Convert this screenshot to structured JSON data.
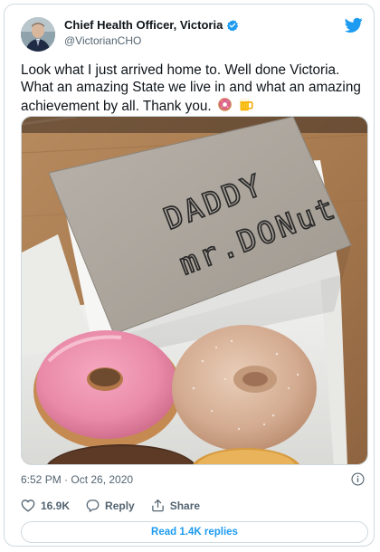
{
  "author": {
    "display_name": "Chief Health Officer, Victoria",
    "handle": "@VictorianCHO",
    "verified": true,
    "avatar_icon": "profile-photo-icon"
  },
  "brand": {
    "logo_icon": "twitter-bird-icon",
    "accent_color": "#1d9bf0"
  },
  "tweet": {
    "text": "Look what I just arrived home to. Well done Victoria. What an amazing State we live in and what an amazing achievement by all. Thank you.",
    "emojis": [
      "donut-emoji-icon",
      "beer-mug-emoji-icon"
    ],
    "timestamp": "6:52 PM · Oct 26, 2020"
  },
  "media": {
    "type": "photo",
    "envelope_text_line1": "DADDY",
    "envelope_text_line2": "mr.DONut"
  },
  "actions": {
    "like_count": "16.9K",
    "reply_label": "Reply",
    "share_label": "Share"
  },
  "replies_button": {
    "label": "Read 1.4K replies"
  }
}
